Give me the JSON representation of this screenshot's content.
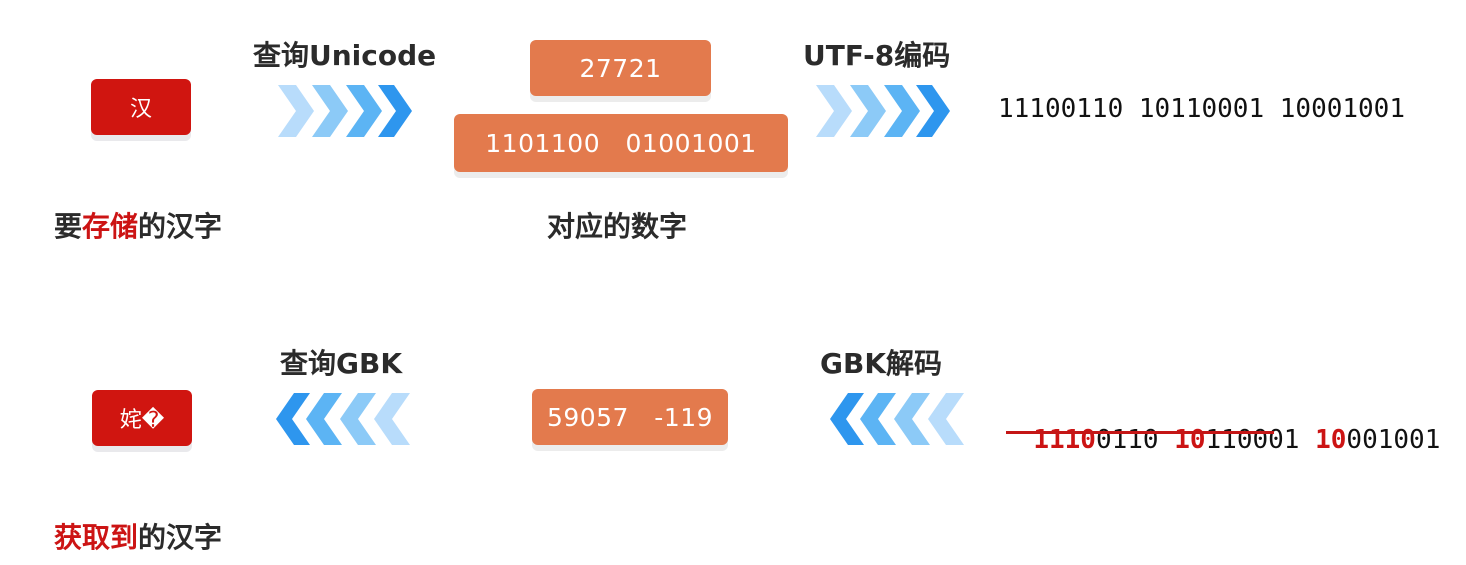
{
  "encode": {
    "source_char": "汉",
    "source_label_pre": "要",
    "source_label_red": "存储",
    "source_label_post": "的汉字",
    "lookup_unicode_label": "查询Unicode",
    "number_decimal": "27721",
    "number_binary": "1101100   01001001",
    "number_label": "对应的数字",
    "utf8_label": "UTF-8编码",
    "utf8_bytes": "11100110 10110001 10001001"
  },
  "decode": {
    "result_char": "姹�",
    "result_label_red": "获取到",
    "result_label_post": "的汉字",
    "lookup_gbk_label": "查询GBK",
    "gbk_numbers": "59057   -119",
    "gbk_decode_label": "GBK解码",
    "bytes": [
      {
        "red": "1110",
        "rest": "0110"
      },
      {
        "red": "10",
        "rest": "110001"
      },
      {
        "red": "10",
        "rest": "001001"
      }
    ]
  },
  "colors": {
    "char_box": "#d01510",
    "num_box": "#e37a4d",
    "highlight": "#cc1414",
    "chevron_shades": [
      "#b8dcfb",
      "#8ccaf7",
      "#5cb4f4",
      "#2e96ee"
    ]
  }
}
